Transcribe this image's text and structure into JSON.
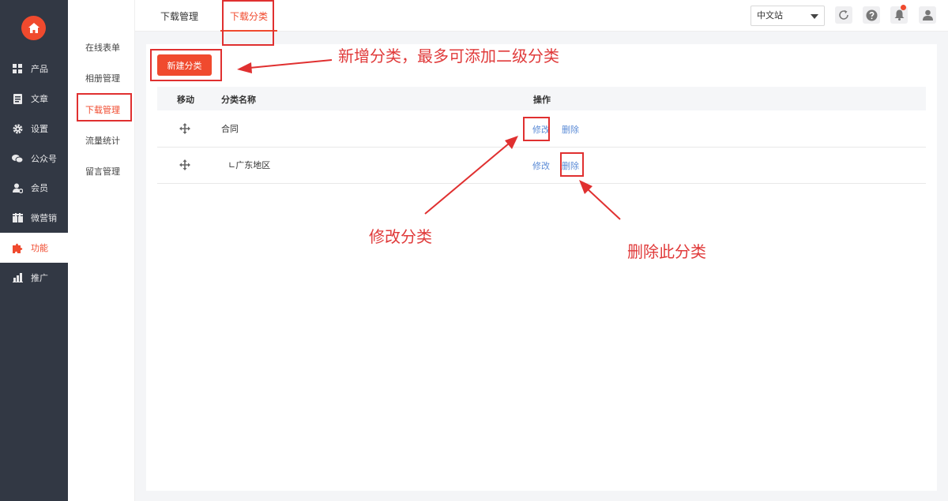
{
  "sidebar": {
    "items": [
      {
        "label": "产品",
        "icon": "grid-icon"
      },
      {
        "label": "文章",
        "icon": "document-icon"
      },
      {
        "label": "设置",
        "icon": "gear-icon"
      },
      {
        "label": "公众号",
        "icon": "wechat-icon"
      },
      {
        "label": "会员",
        "icon": "member-icon"
      },
      {
        "label": "微营销",
        "icon": "marketing-icon"
      },
      {
        "label": "功能",
        "icon": "puzzle-icon",
        "active": true
      },
      {
        "label": "推广",
        "icon": "bar-chart-icon"
      }
    ]
  },
  "submenu": {
    "items": [
      {
        "label": "在线表单"
      },
      {
        "label": "相册管理"
      },
      {
        "label": "下载管理",
        "active": true
      },
      {
        "label": "流量统计"
      },
      {
        "label": "留言管理"
      }
    ]
  },
  "topbar": {
    "tabs": [
      {
        "label": "下载管理"
      },
      {
        "label": "下载分类",
        "active": true
      }
    ],
    "language": "中文站"
  },
  "toolbar": {
    "new_label": "新建分类"
  },
  "table": {
    "headers": {
      "move": "移动",
      "name": "分类名称",
      "actions": "操作"
    },
    "rows": [
      {
        "name": "合同",
        "edit": "修改",
        "delete": "删除"
      },
      {
        "name": "∟广东地区",
        "edit": "修改",
        "delete": "删除"
      }
    ]
  },
  "annotations": {
    "new_category": "新增分类，最多可添加二级分类",
    "edit_category": "修改分类",
    "delete_category": "删除此分类"
  },
  "colors": {
    "accent": "#f04a2e",
    "sidebar_bg": "#323844",
    "link": "#5b8bd6",
    "annotation": "#e03030"
  }
}
